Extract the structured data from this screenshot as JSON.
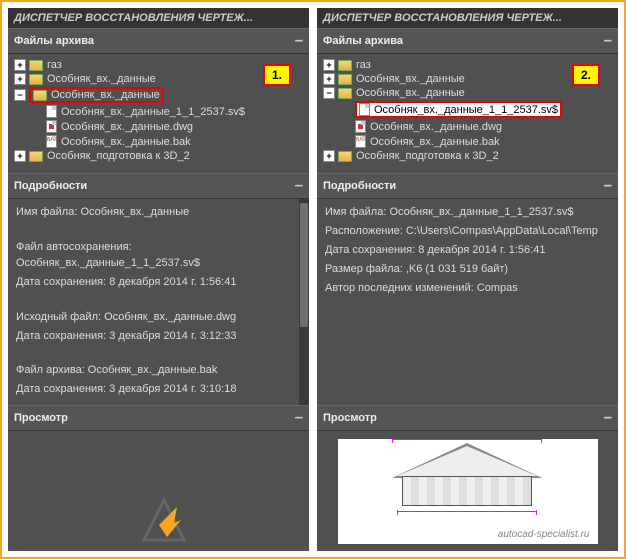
{
  "left": {
    "title": "ДИСПЕТЧЕР ВОССТАНОВЛЕНИЯ ЧЕРТЕЖ...",
    "badge": "1.",
    "sections": {
      "archive": "Файлы архива",
      "details": "Подробности",
      "preview": "Просмотр"
    },
    "tree": {
      "n0": "газ",
      "n1": "Особняк_вх._данные",
      "n2": "Особняк_вх._данные",
      "n2a": "Особняк_вх._данные_1_1_2537.sv$",
      "n2b": "Особняк_вх._данные.dwg",
      "n2c": "Особняк_вх._данные.bak",
      "n3": "Особняк_подготовка к 3D_2"
    },
    "details": {
      "l1": "Имя файла: Особняк_вх._данные",
      "l2": "Файл автосохранения: Особняк_вх._данные_1_1_2537.sv$",
      "l3": "Дата сохранения: 8 декабря 2014 г.  1:56:41",
      "l4": "Исходный файл: Особняк_вх._данные.dwg",
      "l5": "Дата сохранения: 3 декабря 2014 г.  3:12:33",
      "l6": "Файл архива: Особняк_вх._данные.bak",
      "l7": "Дата сохранения: 3 декабря 2014 г.  3:10:18"
    }
  },
  "right": {
    "title": "ДИСПЕТЧЕР ВОССТАНОВЛЕНИЯ ЧЕРТЕЖ...",
    "badge": "2.",
    "sections": {
      "archive": "Файлы архива",
      "details": "Подробности",
      "preview": "Просмотр"
    },
    "tree": {
      "n0": "газ",
      "n1": "Особняк_вх._данные",
      "n2": "Особняк_вх._данные",
      "n2a": "Особняк_вх._данные_1_1_2537.sv$",
      "n2b": "Особняк_вх._данные.dwg",
      "n2c": "Особняк_вх._данные.bak",
      "n3": "Особняк_подготовка к 3D_2"
    },
    "details": {
      "l1": "Имя файла: Особняк_вх._данные_1_1_2537.sv$",
      "l2": "Расположение: C:\\Users\\Compas\\AppData\\Local\\Temp",
      "l3": "Дата сохранения: 8 декабря 2014 г.  1:56:41",
      "l4": "Размер файла: ,K6 (1 031 519 байт)",
      "l5": "Автор последних изменений: Compas"
    },
    "watermark": "autocad-specialist.ru"
  }
}
